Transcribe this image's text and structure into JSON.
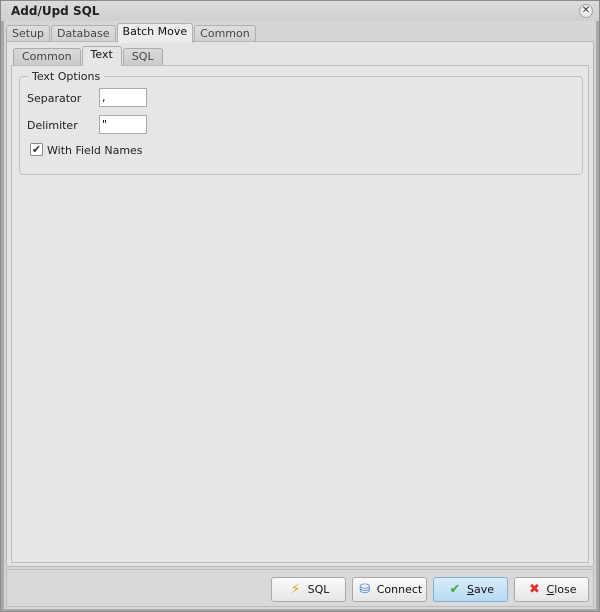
{
  "window": {
    "title": "Add/Upd SQL",
    "close_icon": "close-icon"
  },
  "tabs": [
    {
      "label": "Setup",
      "active": false
    },
    {
      "label": "Database",
      "active": false
    },
    {
      "label": "Batch Move",
      "active": true
    },
    {
      "label": "Common",
      "active": false
    }
  ],
  "subtabs": [
    {
      "label": "Common",
      "active": false
    },
    {
      "label": "Text",
      "active": true
    },
    {
      "label": "SQL",
      "active": false
    }
  ],
  "text_options": {
    "group_label": "Text Options",
    "separator_label": "Separator",
    "separator_value": ",",
    "delimiter_label": "Delimiter",
    "delimiter_value": "\"",
    "with_field_names_label": "With Field Names",
    "with_field_names_checked": true
  },
  "footer": {
    "sql_label": "SQL",
    "connect_label": "Connect",
    "save_accel": "S",
    "save_rest": "ave",
    "close_accel": "C",
    "close_rest": "lose"
  }
}
